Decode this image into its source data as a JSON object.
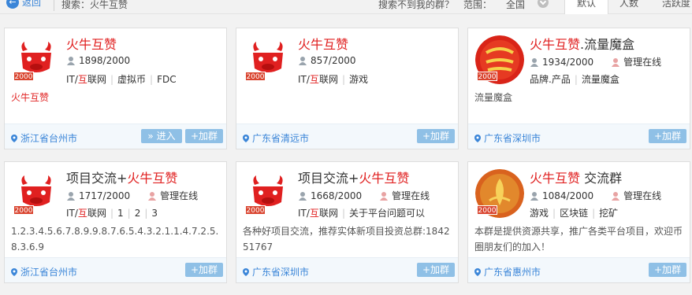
{
  "topbar": {
    "back_label": "返回",
    "search_text": "搜索：火牛互赞",
    "not_found": "搜索不到我的群？",
    "range_label": "范围：",
    "range_value": "全国",
    "tabs": [
      "默认",
      "人数",
      "活跃度"
    ]
  },
  "cards": [
    {
      "name_red": "火牛互赞",
      "name_plain": "",
      "members": "1898/2000",
      "admin": "",
      "tags": [
        {
          "pre": "IT/",
          "red": "互",
          "post": "联网"
        },
        {
          "pre": "虚拟币"
        },
        {
          "pre": "FDC"
        }
      ],
      "desc": "火牛互赞",
      "desc_red": true,
      "location": "浙江省台州市",
      "enter_label": "» 进入",
      "join_label": "+加群",
      "badge": "2000"
    },
    {
      "name_red": "火牛互赞",
      "name_plain": "",
      "members": "857/2000",
      "admin": "",
      "tags": [
        {
          "pre": "IT/",
          "red": "互",
          "post": "联网"
        },
        {
          "pre": "游戏"
        }
      ],
      "desc": "",
      "desc_red": false,
      "location": "广东省清远市",
      "join_label": "+加群",
      "badge": "2000"
    },
    {
      "name_red": "火牛互赞",
      "name_plain": ".流量魔盒",
      "members": "1934/2000",
      "admin": "管理在线",
      "tags": [
        {
          "pre": "品牌.产品"
        },
        {
          "pre": "流量魔盒"
        }
      ],
      "desc": "流量魔盒",
      "desc_red": false,
      "location": "广东省深圳市",
      "join_label": "+加群",
      "badge": "2000"
    },
    {
      "name_prefix": "项目交流+",
      "name_red": "火牛互赞",
      "name_plain": "",
      "members": "1717/2000",
      "admin": "管理在线",
      "tags": [
        {
          "pre": "IT/",
          "red": "互",
          "post": "联网"
        },
        {
          "pre": "1"
        },
        {
          "pre": "2"
        },
        {
          "pre": "3"
        }
      ],
      "desc": "1.2.3.4.5.6.7.8.9.9.8.7.6.5.4.3.2.1.1.4.7.2.5.8.3.6.9",
      "desc_red": false,
      "location": "浙江省台州市",
      "join_label": "+加群",
      "badge": "2000"
    },
    {
      "name_prefix": "项目交流+",
      "name_red": "火牛互赞",
      "name_plain": "",
      "members": "1668/2000",
      "admin": "管理在线",
      "tags": [
        {
          "pre": "IT/",
          "red": "互",
          "post": "联网"
        },
        {
          "pre": "关于平台问题可以"
        }
      ],
      "desc": "各种好项目交流，推荐实体新项目投资总群:1842 51767",
      "desc_red": false,
      "location": "广东省深圳市",
      "join_label": "+加群",
      "badge": "2000"
    },
    {
      "name_red": "火牛互赞",
      "name_plain": " 交流群",
      "members": "1084/2000",
      "admin": "管理在线",
      "tags": [
        {
          "pre": "游戏"
        },
        {
          "pre": "区块链"
        },
        {
          "pre": "挖矿"
        }
      ],
      "desc": "本群是提供资源共享，推广各类平台项目，欢迎币圈朋友们的加入！",
      "desc_red": false,
      "location": "广东省惠州市",
      "join_label": "+加群",
      "badge": "2000"
    }
  ],
  "colors": {
    "accent": "#3a85d8",
    "red": "#e02020",
    "button": "#8fc0e6",
    "badge": "#d9442f"
  }
}
